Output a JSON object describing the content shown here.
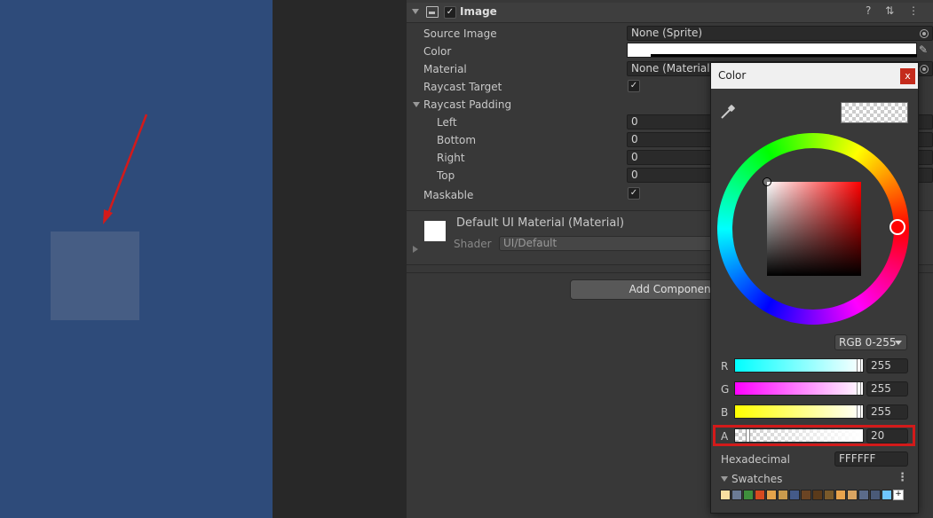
{
  "component": {
    "title": "Image",
    "enabled": true,
    "tools": "? ⇅ ⋮"
  },
  "properties": {
    "source_image": {
      "label": "Source Image",
      "value": "None (Sprite)"
    },
    "color": {
      "label": "Color",
      "value": "#FFFFFF"
    },
    "material": {
      "label": "Material",
      "value": "None (Material)"
    },
    "raycast_target": {
      "label": "Raycast Target",
      "checked": true,
      "mark": "✓"
    },
    "raycast_padding": {
      "label": "Raycast Padding",
      "left": {
        "label": "Left",
        "value": "0"
      },
      "bottom": {
        "label": "Bottom",
        "value": "0"
      },
      "right": {
        "label": "Right",
        "value": "0"
      },
      "top": {
        "label": "Top",
        "value": "0"
      }
    },
    "maskable": {
      "label": "Maskable",
      "checked": true,
      "mark": "✓"
    }
  },
  "material_block": {
    "name": "Default UI Material (Material)",
    "shader_label": "Shader",
    "shader_value": "UI/Default"
  },
  "add_component": {
    "label": "Add Component"
  },
  "color_popup": {
    "title": "Color",
    "close": "x",
    "mode": "RGB 0-255",
    "channels": [
      {
        "label": "R",
        "value": "255"
      },
      {
        "label": "G",
        "value": "255"
      },
      {
        "label": "B",
        "value": "255"
      },
      {
        "label": "A",
        "value": "20"
      }
    ],
    "hex_label": "Hexadecimal",
    "hex_value": "FFFFFF",
    "swatches_label": "Swatches",
    "swatches_menu": "⋮",
    "swatch_colors": [
      "#f8dfa0",
      "#6b7b96",
      "#3e8f3c",
      "#d74a1f",
      "#e4a34a",
      "#c99a4c",
      "#445a88",
      "#6b4423",
      "#5a3a1a",
      "#7a5a2a",
      "#e8a34c",
      "#d9a461",
      "#5b6b8a",
      "#4a5a78",
      "#6ec6ff"
    ]
  },
  "colors": {
    "scene_bg": "#2e4b7a",
    "highlight": "#d31a1a",
    "hue_handle": "#ff0000"
  },
  "icons": {
    "eyedropper": "eyedropper-icon",
    "image_component": "image-component-icon",
    "object_picker": "object-picker-icon"
  }
}
